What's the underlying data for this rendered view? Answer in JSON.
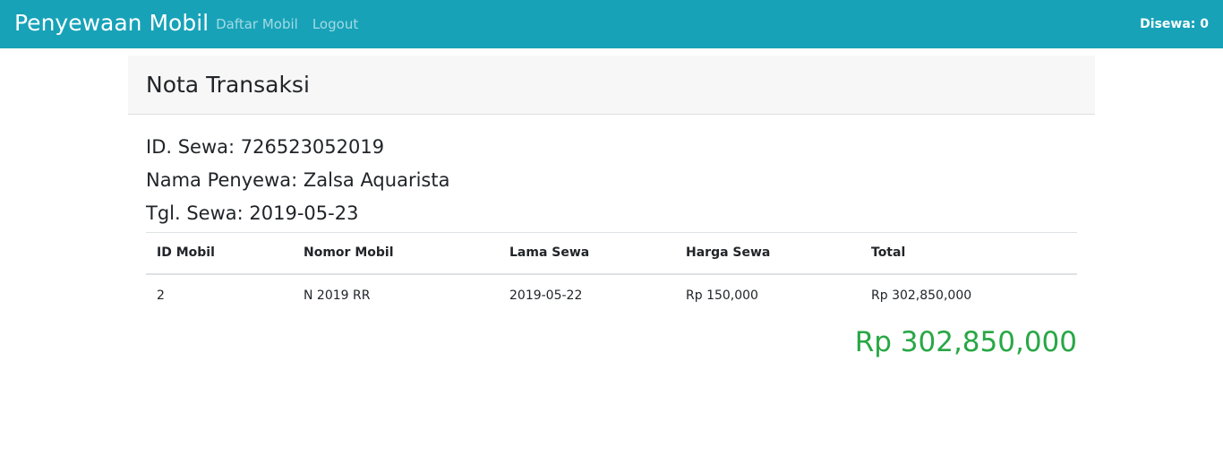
{
  "navbar": {
    "brand": "Penyewaan Mobil",
    "links": [
      "Daftar Mobil",
      "Logout"
    ],
    "rented_status": "Disewa: 0",
    "bg_color": "#17a2b8"
  },
  "card": {
    "title": "Nota Transaksi",
    "info": {
      "rental_id": "ID. Sewa: 726523052019",
      "renter_name": "Nama Penyewa: Zalsa Aquarista",
      "rental_date": "Tgl. Sewa: 2019-05-23"
    },
    "table": {
      "headers": [
        "ID Mobil",
        "Nomor Mobil",
        "Lama Sewa",
        "Harga Sewa",
        "Total"
      ],
      "rows": [
        [
          "2",
          "N 2019 RR",
          "2019-05-22",
          "Rp 150,000",
          "Rp 302,850,000"
        ]
      ]
    },
    "grand_total": "Rp 302,850,000",
    "total_color": "#28a745"
  }
}
